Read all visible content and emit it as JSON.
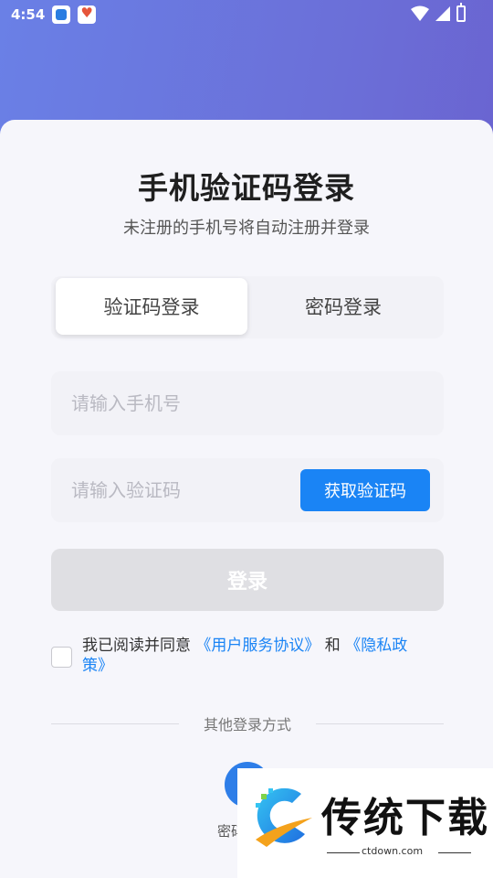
{
  "status_bar": {
    "time": "4:54",
    "icons": [
      "app-icon-blue",
      "app-icon-heart",
      "wifi-icon",
      "signal-icon",
      "battery-icon"
    ]
  },
  "login": {
    "title": "手机验证码登录",
    "subtitle": "未注册的手机号将自动注册并登录",
    "tabs": [
      {
        "label": "验证码登录",
        "active": true
      },
      {
        "label": "密码登录",
        "active": false
      }
    ],
    "phone_placeholder": "请输入手机号",
    "code_placeholder": "请输入验证码",
    "get_code_label": "获取验证码",
    "submit_label": "登录",
    "agreement": {
      "prefix": "我已阅读并同意 ",
      "user_agreement": "《用户服务协议》",
      "conjunction": " 和 ",
      "privacy_policy": "《隐私政策》"
    },
    "other_methods_label": "其他登录方式",
    "alt_method_label": "密码"
  },
  "watermark": {
    "name": "传统下载",
    "url": "ctdown.com"
  },
  "colors": {
    "accent": "#1a84f5",
    "header_gradient_start": "#6a80e6",
    "header_gradient_end": "#6a5ccb",
    "disabled_button": "#dfdfe3"
  }
}
